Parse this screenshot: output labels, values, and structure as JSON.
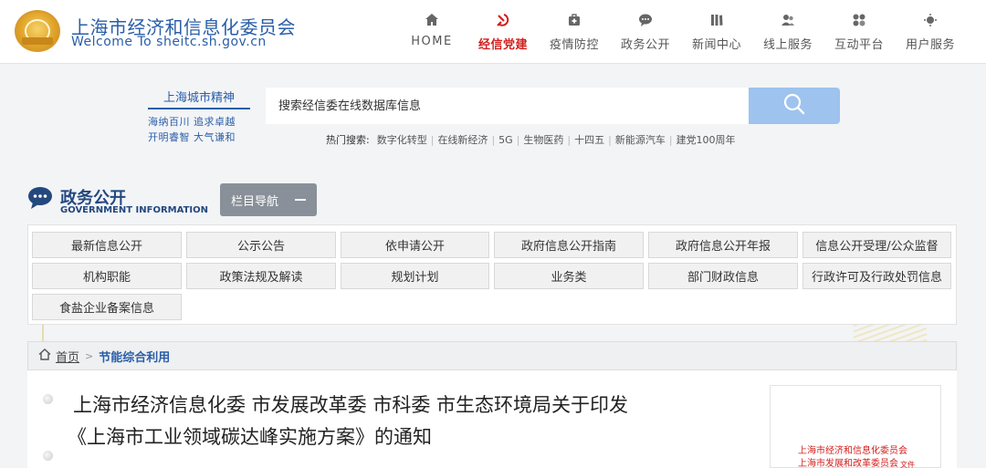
{
  "header": {
    "site_title_cn": "上海市经济和信息化委员会",
    "site_title_en": "Welcome To sheitc.sh.gov.cn",
    "nav": [
      {
        "label": "HOME",
        "icon": "home-icon"
      },
      {
        "label": "经信党建",
        "icon": "hammer-sickle-icon",
        "active": true
      },
      {
        "label": "疫情防控",
        "icon": "medical-kit-icon"
      },
      {
        "label": "政务公开",
        "icon": "chat-bubble-icon"
      },
      {
        "label": "新闻中心",
        "icon": "newspaper-icon"
      },
      {
        "label": "线上服务",
        "icon": "people-icon"
      },
      {
        "label": "互动平台",
        "icon": "interaction-icon"
      },
      {
        "label": "用户服务",
        "icon": "user-service-icon"
      }
    ]
  },
  "spirit": {
    "title": "上海城市精神",
    "line1": "海纳百川 追求卓越",
    "line2": "开明睿智 大气谦和"
  },
  "search": {
    "placeholder": "搜索经信委在线数据库信息",
    "hot_label": "热门搜索:",
    "hot_keywords": [
      "数字化转型",
      "在线新经济",
      "5G",
      "生物医药",
      "十四五",
      "新能源汽车",
      "建党100周年"
    ]
  },
  "section": {
    "title_cn": "政务公开",
    "title_en": "GOVERNMENT INFORMATION",
    "toggle_label": "栏目导航"
  },
  "categories": [
    "最新信息公开",
    "公示公告",
    "依申请公开",
    "政府信息公开指南",
    "政府信息公开年报",
    "信息公开受理/公众监督",
    "机构职能",
    "政策法规及解读",
    "规划计划",
    "业务类",
    "部门财政信息",
    "行政许可及行政处罚信息",
    "食盐企业备案信息"
  ],
  "breadcrumb": {
    "home": "首页",
    "separator": ">",
    "current": "节能综合利用"
  },
  "article": {
    "title_line1": "上海市经济信息化委 市发展改革委 市科委 市生态环境局关于印发",
    "title_line2": "《上海市工业领域碳达峰实施方案》的通知"
  },
  "document_preview": {
    "issuer1": "上海市经济和信息化委员会",
    "issuer2": "上海市发展和改革委员会",
    "suffix": "文件"
  },
  "colors": {
    "brand_blue": "#2a5ea8",
    "active_red": "#d0201d",
    "search_button": "#9dc3ee",
    "toggle_gray": "#8a9099"
  }
}
